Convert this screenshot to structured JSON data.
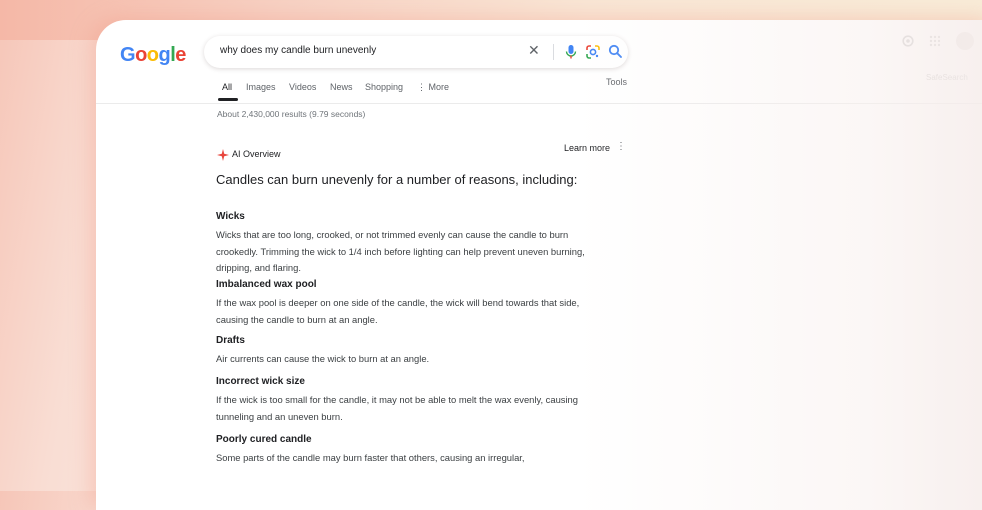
{
  "search": {
    "query": "why does my candle burn unevenly"
  },
  "logo": {
    "letters": [
      "G",
      "o",
      "o",
      "g",
      "l",
      "e"
    ]
  },
  "tabs": [
    {
      "label": "All",
      "active": true
    },
    {
      "label": "Images",
      "active": false
    },
    {
      "label": "Videos",
      "active": false
    },
    {
      "label": "News",
      "active": false
    },
    {
      "label": "Shopping",
      "active": false
    },
    {
      "label": "More",
      "active": false
    }
  ],
  "tools_label": "Tools",
  "safesearch_label": "SafeSearch",
  "result_stats": "About 2,430,000 results (9.79 seconds)",
  "ai_overview": {
    "label": "AI Overview",
    "learn_more": "Learn more",
    "headline": "Candles can burn unevenly for a number of reasons, including:",
    "sections": [
      {
        "title": "Wicks",
        "body": "Wicks that are too long, crooked, or not trimmed evenly can cause the candle to burn crookedly. Trimming the wick to 1/4 inch before lighting can help prevent uneven burning, dripping, and flaring."
      },
      {
        "title": "Imbalanced wax pool",
        "body": "If the wax pool is deeper on one side of the candle, the wick will bend towards that side, causing the candle to burn at an angle."
      },
      {
        "title": "Drafts",
        "body": "Air currents can cause the wick to burn at an angle."
      },
      {
        "title": "Incorrect wick size",
        "body": "If the wick is too small for the candle, it may not be able to melt the wax evenly, causing tunneling and an uneven burn."
      },
      {
        "title": "Poorly cured candle",
        "body": "Some parts of the candle may burn faster that others, causing an irregular,"
      }
    ]
  },
  "colors": {
    "google_blue": "#4285f4",
    "google_red": "#ea4335",
    "google_yellow": "#fbbc05",
    "google_green": "#34a853",
    "ai_spark": "#e8453c",
    "text_primary": "#202124"
  },
  "icons": [
    "clear-icon",
    "mic-icon",
    "lens-icon",
    "search-icon",
    "settings-icon",
    "apps-grid-icon",
    "avatar",
    "ai-sparkle-icon",
    "more-vert-icon"
  ]
}
